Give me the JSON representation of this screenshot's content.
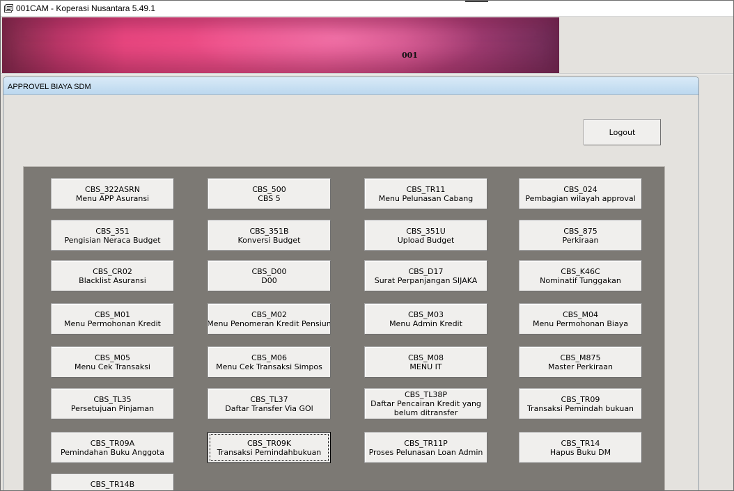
{
  "window": {
    "title": "001CAM - Koperasi Nusantara 5.49.1",
    "icon": "app-window-icon"
  },
  "banner": {
    "branch_code": "001"
  },
  "panel": {
    "title": "APPROVEL BIAYA SDM"
  },
  "logout": {
    "label": "Logout"
  },
  "menu_items": [
    {
      "code": "CBS_322ASRN",
      "name": "Menu APP Asuransi"
    },
    {
      "code": "CBS_500",
      "name": "CBS 5"
    },
    {
      "code": "CBS_TR11",
      "name": "Menu Pelunasan Cabang"
    },
    {
      "code": "CBS_024",
      "name": "Pembagian wilayah approval"
    },
    {
      "code": "CBS_351",
      "name": "Pengisian Neraca Budget"
    },
    {
      "code": "CBS_351B",
      "name": "Konversi Budget"
    },
    {
      "code": "CBS_351U",
      "name": "Upload Budget"
    },
    {
      "code": "CBS_875",
      "name": "Perkiraan"
    },
    {
      "code": "CBS_CR02",
      "name": "Blacklist Asuransi"
    },
    {
      "code": "CBS_D00",
      "name": "D00"
    },
    {
      "code": "CBS_D17",
      "name": "Surat Perpanjangan SIJAKA"
    },
    {
      "code": "CBS_K46C",
      "name": "Nominatif Tunggakan"
    },
    {
      "code": "CBS_M01",
      "name": "Menu Permohonan Kredit"
    },
    {
      "code": "CBS_M02",
      "name": "Menu Penomeran Kredit Pensiun"
    },
    {
      "code": "CBS_M03",
      "name": "Menu Admin Kredit"
    },
    {
      "code": "CBS_M04",
      "name": "Menu Permohonan Biaya"
    },
    {
      "code": "CBS_M05",
      "name": "Menu Cek Transaksi"
    },
    {
      "code": "CBS_M06",
      "name": "Menu Cek Transaksi Simpos"
    },
    {
      "code": "CBS_M08",
      "name": "MENU IT"
    },
    {
      "code": "CBS_M875",
      "name": "Master Perkiraan"
    },
    {
      "code": "CBS_TL35",
      "name": "Persetujuan Pinjaman"
    },
    {
      "code": "CBS_TL37",
      "name": "Daftar Transfer Via GOl"
    },
    {
      "code": "CBS_TL38P",
      "name": "Daftar Pencairan Kredit yang",
      "name2": "belum ditransfer"
    },
    {
      "code": "CBS_TR09",
      "name": "Transaksi Pemindah bukuan"
    },
    {
      "code": "CBS_TR09A",
      "name": "Pemindahan Buku Anggota"
    },
    {
      "code": "CBS_TR09K",
      "name": "Transaksi Pemindahbukuan",
      "focused": true
    },
    {
      "code": "CBS_TR11P",
      "name": "Proses Pelunasan Loan Admin"
    },
    {
      "code": "CBS_TR14",
      "name": "Hapus Buku DM"
    },
    {
      "code": "CBS_TR14B",
      "name": ""
    }
  ]
}
